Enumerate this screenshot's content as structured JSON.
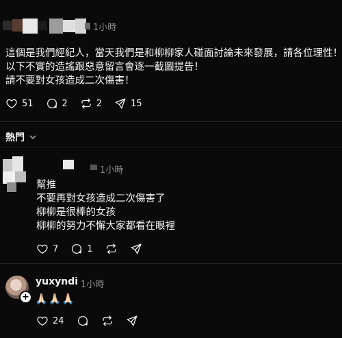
{
  "post1": {
    "time": "1小時",
    "lines": [
      "這個是我們經紀人，當天我們是和柳柳家人碰面討論未來發展，請各位理性！",
      "以下不實的造謠跟惡意留言會逐一截圖提告！",
      "請不要對女孩造成二次傷害！"
    ],
    "likes": "51",
    "replies": "2",
    "reposts": "2",
    "shares": "15"
  },
  "sort": {
    "label": "熱門"
  },
  "post2": {
    "time": "1小時",
    "lines": [
      "幫推",
      "不要再對女孩造成二次傷害了",
      "柳柳是很棒的女孩",
      "柳柳的努力不懈大家都看在眼裡"
    ],
    "likes": "7",
    "replies": "1"
  },
  "post3": {
    "username": "yuxyndi",
    "time": "1小時",
    "text": "🙏🏻🙏🏻🙏🏻",
    "likes": "24"
  },
  "icons": {
    "like": "heart-icon",
    "reply": "comment-icon",
    "repost": "repost-icon",
    "share": "send-icon"
  },
  "colors": {
    "background": "#0a0a0a",
    "text": "#f3f3f3",
    "muted": "#8e8e8e"
  }
}
